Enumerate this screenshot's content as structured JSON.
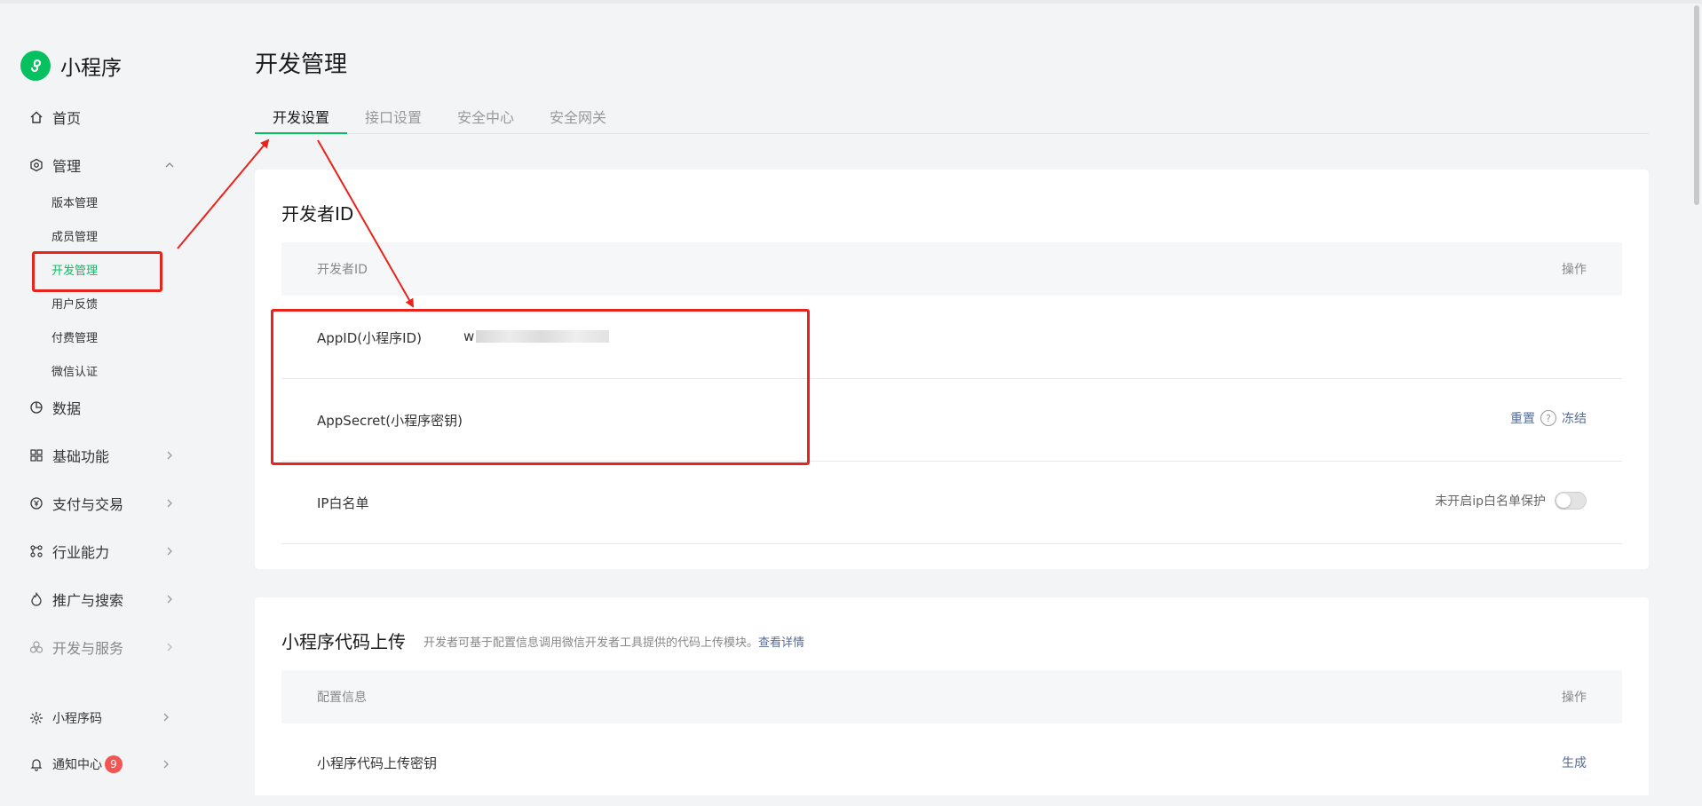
{
  "app": {
    "name": "小程序",
    "color_brand": "#07c160"
  },
  "sidebar": {
    "home": "首页",
    "manage": "管理",
    "manage_sub": [
      "版本管理",
      "成员管理",
      "开发管理",
      "用户反馈",
      "付费管理",
      "微信认证"
    ],
    "data": "数据",
    "basic": "基础功能",
    "pay": "支付与交易",
    "industry": "行业能力",
    "promotion": "推广与搜索",
    "devservice": "开发与服务",
    "qrcode": "小程序码",
    "notice": "通知中心",
    "notice_count": "9"
  },
  "main": {
    "title": "开发管理",
    "tabs": [
      "开发设置",
      "接口设置",
      "安全中心",
      "安全网关"
    ]
  },
  "developer_id": {
    "title": "开发者ID",
    "table_head": {
      "name": "开发者ID",
      "action": "操作"
    },
    "appid_label": "AppID(小程序ID)",
    "appid_value_visible": "w",
    "appsecret_label": "AppSecret(小程序密钥)",
    "reset": "重置",
    "help_icon_glyph": "?",
    "freeze": "冻结",
    "ip_label": "IP白名单",
    "ip_status": "未开启ip白名单保护",
    "ip_toggle_on": false
  },
  "upload": {
    "title": "小程序代码上传",
    "desc": "开发者可基于配置信息调用微信开发者工具提供的代码上传模块。",
    "desc_link": "查看详情",
    "table_head": {
      "name": "配置信息",
      "action": "操作"
    },
    "key_label": "小程序代码上传密钥",
    "generate": "生成"
  },
  "colors": {
    "annotation": "#e8231c",
    "link": "#576b95",
    "active_tab": "#07c160",
    "badge": "#f35454"
  }
}
